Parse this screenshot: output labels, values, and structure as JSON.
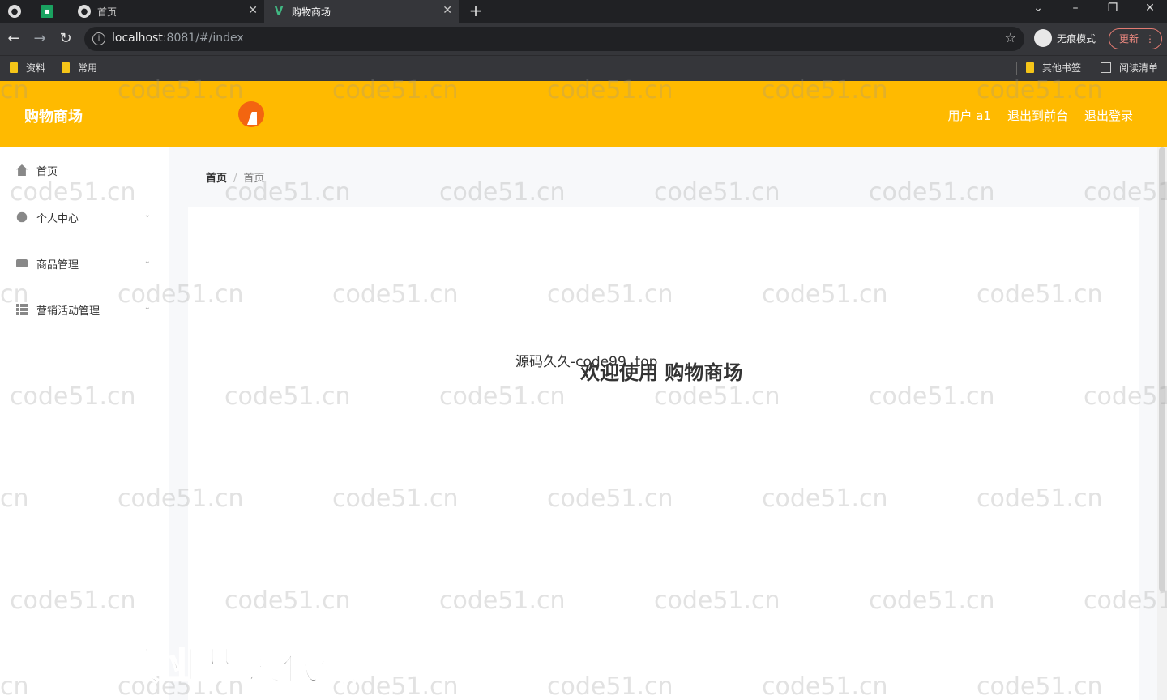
{
  "browser": {
    "tabs": [
      {
        "label": "首页"
      },
      {
        "label": "购物商场"
      }
    ],
    "url_host": "localhost",
    "url_rest": ":8081/#/index",
    "incognito_label": "无痕模式",
    "update_label": "更新",
    "bookmarks": [
      "资料",
      "常用"
    ],
    "bookmarks_right": [
      "其他书签",
      "阅读清单"
    ]
  },
  "header": {
    "title": "购物商场",
    "user_label": "用户 a1",
    "back_front_label": "退出到前台",
    "logout_label": "退出登录"
  },
  "sidebar": {
    "items": [
      {
        "label": "首页",
        "icon": "home-icon"
      },
      {
        "label": "个人中心",
        "icon": "user-icon"
      },
      {
        "label": "商品管理",
        "icon": "bag-icon"
      },
      {
        "label": "营销活动管理",
        "icon": "grid-icon"
      }
    ]
  },
  "breadcrumb": {
    "root": "首页",
    "current": "首页"
  },
  "main": {
    "source_text": "源码久久-code99. top",
    "welcome_text": "欢迎使用 购物商场"
  },
  "overlay": {
    "watermark_text": "code51.cn",
    "ad_text": "专业毕设代做"
  },
  "colors": {
    "header_bg": "#ffba00",
    "browser_bg": "#35363a"
  }
}
